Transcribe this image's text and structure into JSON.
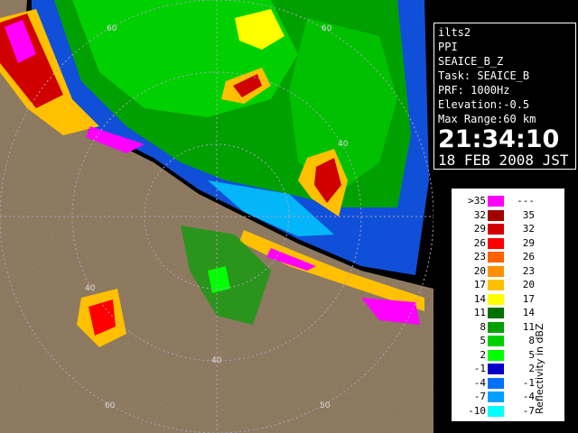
{
  "info": {
    "radar": "ilts2",
    "scan_type": "PPI",
    "product": "SEAICE_B_Z",
    "task": "Task: SEAICE_B",
    "prf": "PRF: 1000Hz",
    "elevation": "Elevation:-0.5",
    "max_range": "Max Range:60 km",
    "time": "21:34:10",
    "date": "18 FEB 2008 JST"
  },
  "range_labels": [
    "60",
    "60",
    "40",
    "40",
    "40",
    "60",
    "50"
  ],
  "legend": {
    "unit": "Reflectivity in dBZ",
    "rows": [
      {
        "lo": ">35",
        "hi": "---",
        "color": "#ff00ff"
      },
      {
        "lo": "32",
        "hi": "35",
        "color": "#a00000"
      },
      {
        "lo": "29",
        "hi": "32",
        "color": "#d00000"
      },
      {
        "lo": "26",
        "hi": "29",
        "color": "#ff0000"
      },
      {
        "lo": "23",
        "hi": "26",
        "color": "#ff6000"
      },
      {
        "lo": "20",
        "hi": "23",
        "color": "#ff9000"
      },
      {
        "lo": "17",
        "hi": "20",
        "color": "#ffc000"
      },
      {
        "lo": "14",
        "hi": "17",
        "color": "#ffff00"
      },
      {
        "lo": "11",
        "hi": "14",
        "color": "#007000"
      },
      {
        "lo": "8",
        "hi": "11",
        "color": "#00a000"
      },
      {
        "lo": "5",
        "hi": "8",
        "color": "#00d000"
      },
      {
        "lo": "2",
        "hi": "5",
        "color": "#00ff00"
      },
      {
        "lo": "-1",
        "hi": "2",
        "color": "#0000c8"
      },
      {
        "lo": "-4",
        "hi": "-1",
        "color": "#0070ff"
      },
      {
        "lo": "-7",
        "hi": "-4",
        "color": "#00a0ff"
      },
      {
        "lo": "-10",
        "hi": "-7",
        "color": "#00ffff"
      }
    ]
  }
}
